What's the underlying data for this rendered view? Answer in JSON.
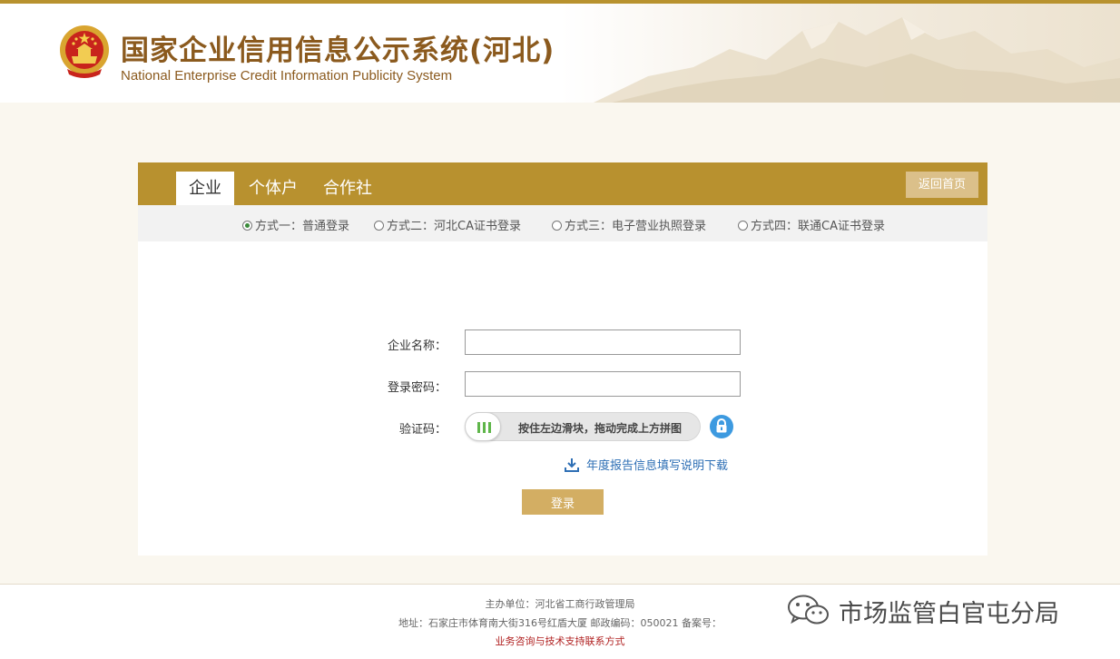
{
  "header": {
    "title": "国家企业信用信息公示系统(河北)",
    "subtitle": "National Enterprise Credit Information Publicity System"
  },
  "tabs": [
    {
      "label": "企业",
      "active": true
    },
    {
      "label": "个体户",
      "active": false
    },
    {
      "label": "合作社",
      "active": false
    }
  ],
  "home_button": "返回首页",
  "login_methods": [
    {
      "label": "方式一：普通登录",
      "selected": true
    },
    {
      "label": "方式二：河北CA证书登录",
      "selected": false
    },
    {
      "label": "方式三：电子营业执照登录",
      "selected": false
    },
    {
      "label": "方式四：联通CA证书登录",
      "selected": false
    }
  ],
  "form": {
    "company_name_label": "企业名称：",
    "company_name_value": "",
    "password_label": "登录密码：",
    "password_value": "",
    "captcha_label": "验证码：",
    "slider_text": "按住左边滑块，拖动完成上方拼图",
    "download_text": "年度报告信息填写说明下载",
    "login_button": "登录"
  },
  "footer": {
    "sponsor": "主办单位：河北省工商行政管理局",
    "address": "地址：石家庄市体育南大街316号红盾大厦 邮政编码：050021 备案号：",
    "support": "业务咨询与技术支持联系方式"
  },
  "watermark": {
    "text": "市场监管白官屯分局"
  },
  "colors": {
    "brand_gold": "#b8912f",
    "title_brown": "#8b5a1e",
    "login_button": "#d3ae63",
    "link_blue": "#2e6fb5",
    "support_red": "#b02020"
  }
}
